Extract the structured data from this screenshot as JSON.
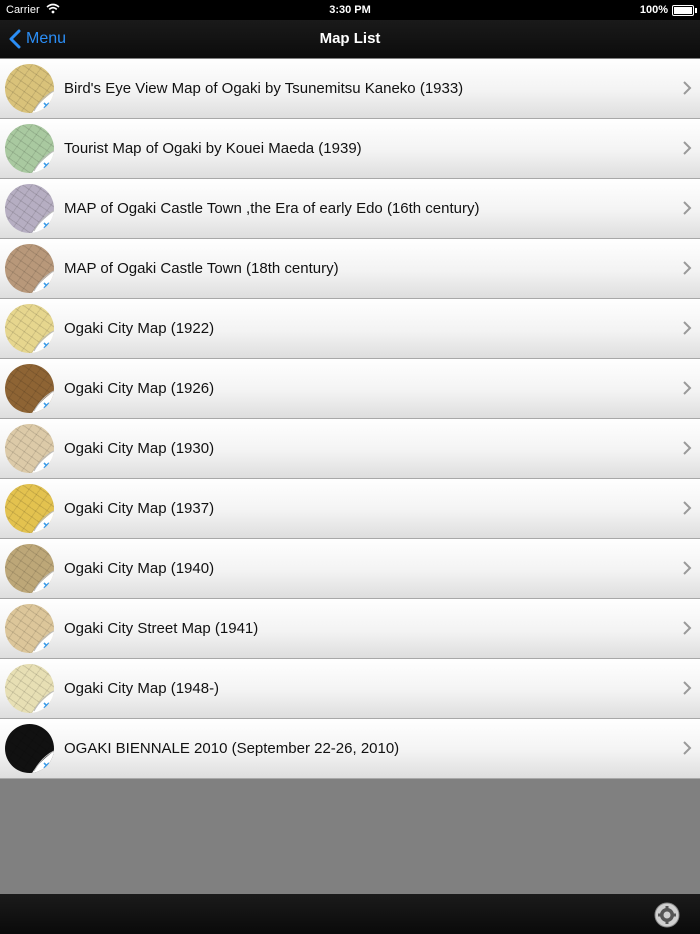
{
  "status_bar": {
    "carrier": "Carrier",
    "time": "3:30 PM",
    "battery": "100%"
  },
  "nav_bar": {
    "back_label": "Menu",
    "title": "Map List"
  },
  "maps": [
    {
      "title": "Bird's Eye View Map of Ogaki by Tsunemitsu Kaneko (1933)",
      "color": "#d9c27a"
    },
    {
      "title": "Tourist Map of Ogaki by Kouei Maeda (1939)",
      "color": "#a9c9a0"
    },
    {
      "title": "MAP of Ogaki Castle Town ,the Era of early Edo (16th century)",
      "color": "#b6aec2"
    },
    {
      "title": "MAP of Ogaki Castle Town (18th century)",
      "color": "#b8987a"
    },
    {
      "title": "Ogaki City Map (1922)",
      "color": "#e6d68e"
    },
    {
      "title": "Ogaki City Map (1926)",
      "color": "#8e6434"
    },
    {
      "title": "Ogaki City Map (1930)",
      "color": "#dccaa8"
    },
    {
      "title": "Ogaki City Map (1937)",
      "color": "#e3c24f"
    },
    {
      "title": "Ogaki City Map (1940)",
      "color": "#bda778"
    },
    {
      "title": "Ogaki City Street Map (1941)",
      "color": "#dcc69a"
    },
    {
      "title": "Ogaki City Map (1948-)",
      "color": "#e7dfb4"
    },
    {
      "title": "OGAKI BIENNALE 2010 (September 22-26, 2010)",
      "color": "#111111"
    }
  ],
  "icons": {
    "back": "chevron-left-icon",
    "disclosure": "chevron-right-icon",
    "settings": "gear-icon"
  },
  "colors": {
    "accent": "#2b8ef6",
    "bar": "#0e0e0e",
    "empty_area": "#808080"
  }
}
